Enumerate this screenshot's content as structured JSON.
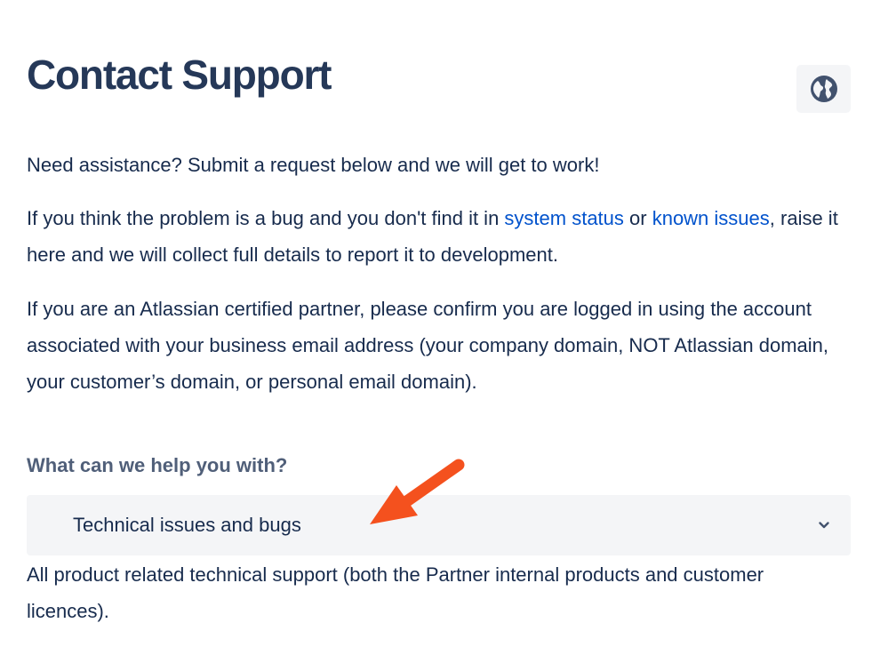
{
  "header": {
    "title": "Contact Support",
    "language_icon": "globe-icon"
  },
  "intro": {
    "paragraph1": "Need assistance? Submit a request below and we will get to work!",
    "paragraph2": {
      "before": "If you think the problem is a bug and you don't find it in ",
      "link1": "system status",
      "middle": " or ",
      "link2": "known issues",
      "after": ", raise it here and we will collect full details to report it to development."
    },
    "paragraph3": "If you are an Atlassian certified partner, please confirm you are logged in using the account associated with your business email address (your company domain, NOT Atlassian domain, your customer’s domain, or personal email domain)."
  },
  "request_type": {
    "label": "What can we help you with?",
    "selected": "Technical issues and bugs",
    "description": "All product related technical support (both the Partner internal products and customer licences).",
    "chevron_icon": "chevron-down-icon"
  },
  "colors": {
    "title": "#253858",
    "body_text": "#172b4d",
    "link": "#0052cc",
    "label": "#505f79",
    "field_background": "#f4f5f7",
    "annotation_arrow": "#f4511e"
  }
}
